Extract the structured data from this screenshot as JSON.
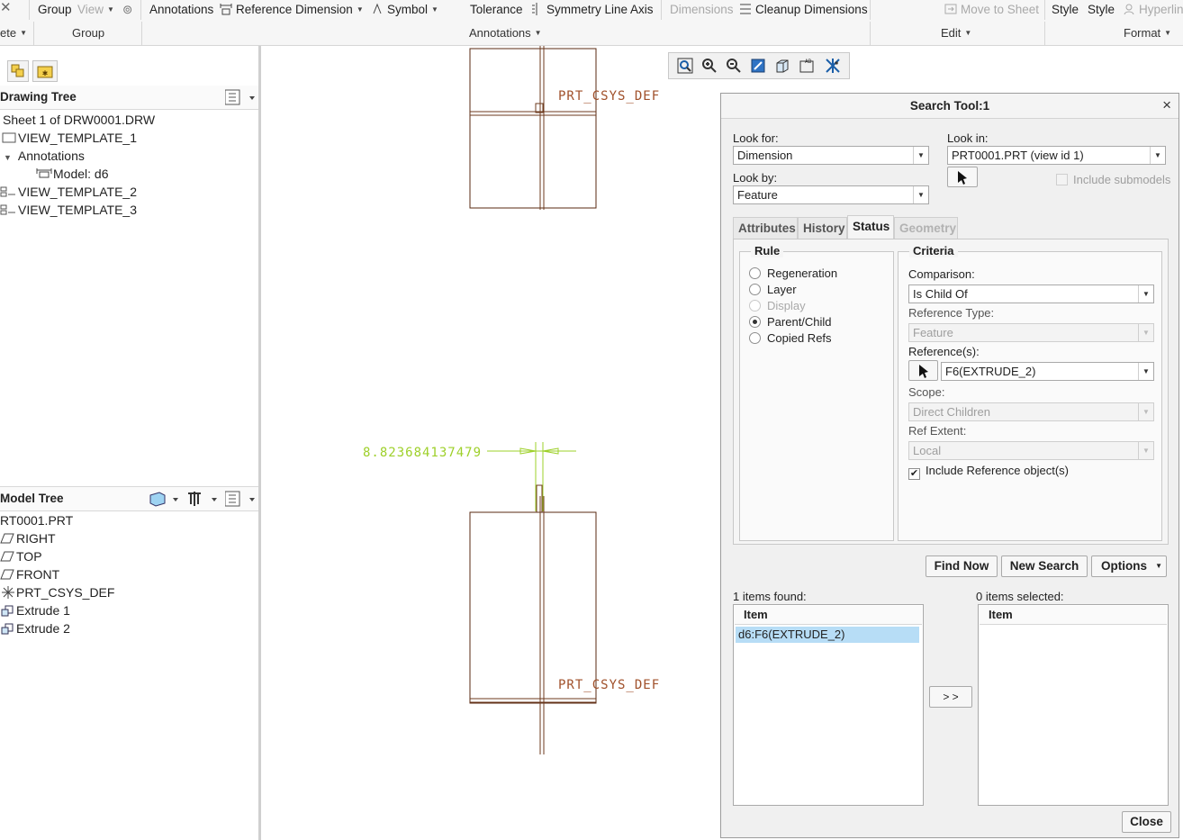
{
  "ribbon": {
    "items": {
      "close": "✕",
      "group": "Group",
      "view": "View",
      "annotations": "Annotations",
      "reference_dimension": "Reference Dimension",
      "symbol": "Symbol",
      "tolerance": "Tolerance",
      "symmetry_line_axis": "Symmetry Line Axis",
      "dimensions": "Dimensions",
      "cleanup_dimensions": "Cleanup Dimensions",
      "move_to_sheet": "Move to Sheet",
      "style1": "Style",
      "style2": "Style",
      "hyperlink": "Hyperlin"
    },
    "groups": {
      "delete": "ete",
      "group": "Group",
      "annotations": "Annotations",
      "edit": "Edit",
      "format": "Format"
    }
  },
  "drawing_tree": {
    "title": "Drawing Tree",
    "rows": [
      "Sheet 1 of DRW0001.DRW",
      "VIEW_TEMPLATE_1",
      "Annotations",
      "Model: d6",
      "VIEW_TEMPLATE_2",
      "VIEW_TEMPLATE_3"
    ]
  },
  "model_tree": {
    "title": "Model Tree",
    "rows": [
      "RT0001.PRT",
      "RIGHT",
      "TOP",
      "FRONT",
      "PRT_CSYS_DEF",
      "Extrude 1",
      "Extrude 2"
    ]
  },
  "canvas": {
    "csys_label_top": "PRT_CSYS_DEF",
    "csys_label_bottom": "PRT_CSYS_DEF",
    "dimension_value": "8.823684137479",
    "colors": {
      "geometry": "#6e3a1e",
      "dimension": "#9ed02a",
      "csys": "#a0502a"
    }
  },
  "dialog": {
    "title": "Search Tool:1",
    "close_glyph": "×",
    "look_for_label": "Look for:",
    "look_for_value": "Dimension",
    "look_in_label": "Look in:",
    "look_in_value": "PRT0001.PRT (view id 1)",
    "include_submodels": "Include submodels",
    "look_by_label": "Look by:",
    "look_by_value": "Feature",
    "tabs": [
      "Attributes",
      "History",
      "Status",
      "Geometry"
    ],
    "rule_legend": "Rule",
    "rules": [
      "Regeneration",
      "Layer",
      "Display",
      "Parent/Child",
      "Copied Refs"
    ],
    "criteria_legend": "Criteria",
    "comparison_label": "Comparison:",
    "comparison_value": "Is Child Of",
    "reference_type_label": "Reference Type:",
    "reference_type_value": "Feature",
    "references_label": "Reference(s):",
    "references_value": "F6(EXTRUDE_2)",
    "scope_label": "Scope:",
    "scope_value": "Direct Children",
    "ref_extent_label": "Ref Extent:",
    "ref_extent_value": "Local",
    "include_reference_objects": "Include Reference object(s)",
    "buttons": {
      "find_now": "Find Now",
      "new_search": "New Search",
      "options": "Options",
      "transfer": "> >",
      "close": "Close"
    },
    "found_label": "1 items found:",
    "selected_label": "0 items selected:",
    "list_header": "Item",
    "found_items": [
      "d6:F6(EXTRUDE_2)"
    ]
  }
}
